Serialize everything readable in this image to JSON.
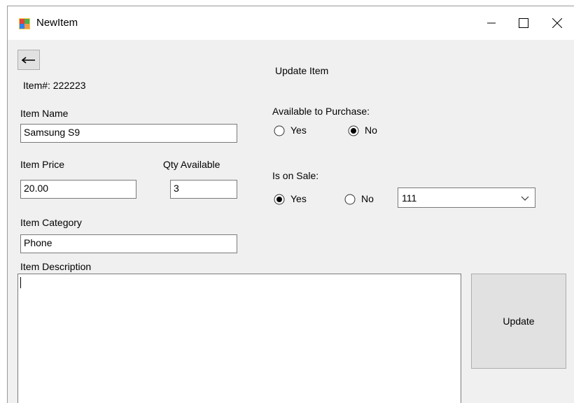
{
  "window": {
    "title": "NewItem",
    "caption_minimize": "minimize",
    "caption_maximize": "maximize",
    "caption_close": "close"
  },
  "form": {
    "back_icon": "←",
    "header": "Update Item",
    "item_number_label": "Item#: 222223",
    "item_name_label": "Item Name",
    "item_name_value": "Samsung S9",
    "item_price_label": "Item Price",
    "item_price_value": "20.00",
    "qty_label": "Qty Available",
    "qty_value": "3",
    "item_category_label": "Item Category",
    "item_category_value": "Phone",
    "item_description_label": "Item Description",
    "item_description_value": "",
    "available_label": "Available to Purchase:",
    "available_yes": "Yes",
    "available_no": "No",
    "available_selected": "No",
    "on_sale_label": "Is on Sale:",
    "on_sale_yes": "Yes",
    "on_sale_no": "No",
    "on_sale_selected": "Yes",
    "sale_combo_value": "111",
    "update_label": "Update"
  },
  "colors": {
    "window_bg": "#f0f0f0",
    "button_bg": "#e1e1e1",
    "border": "#7a7a7a"
  }
}
